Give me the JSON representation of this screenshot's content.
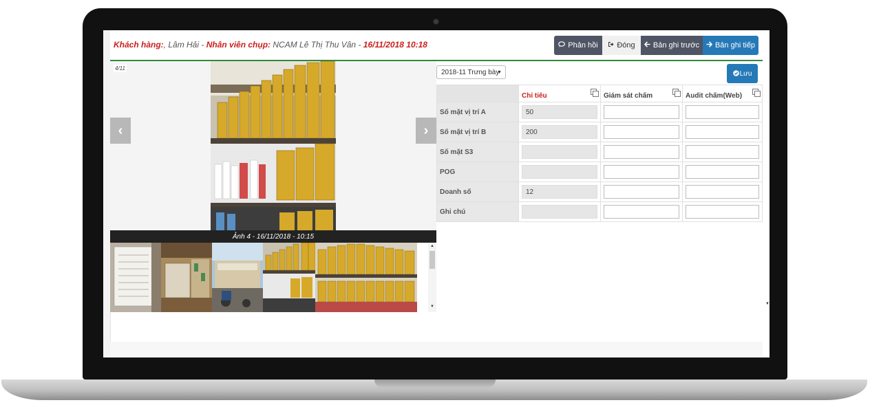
{
  "header": {
    "customer_label": "Khách hàng:",
    "customer_value": ", Lâm Hải",
    "sep1": " - ",
    "staff_label": "Nhân viên chụp:",
    "staff_value": " NCAM Lê Thị Thu Vân",
    "sep2": " - ",
    "datetime": "16/11/2018 10:18"
  },
  "toolbar": {
    "feedback_label": "Phản hồi",
    "close_label": "Đóng",
    "prev_label": "Bản ghi trước",
    "next_label": "Bản ghi tiếp"
  },
  "viewer": {
    "counter": "4/11",
    "caption": "Ảnh 4 - 16/11/2018 - 10:15"
  },
  "form": {
    "period_select": "2018-11 Trưng bày",
    "save_label": "Lưu",
    "columns": [
      "",
      "Chỉ tiêu",
      "Giám sát chấm",
      "Audit chấm(Web)"
    ],
    "rows": [
      {
        "label": "Số mặt vị trí A",
        "target": "50"
      },
      {
        "label": "Số mặt vị trí B",
        "target": "200"
      },
      {
        "label": "Số mặt S3",
        "target": ""
      },
      {
        "label": "POG",
        "target": ""
      },
      {
        "label": "Doanh số",
        "target": "12"
      },
      {
        "label": "Ghi chú",
        "target": ""
      }
    ]
  },
  "colors": {
    "accent_red": "#c9201e",
    "primary_blue": "#2679b7",
    "dark_button": "#4f5564",
    "header_rule": "#2f8a3a"
  },
  "icons": [
    "comment-icon",
    "sign-out-icon",
    "arrow-left-icon",
    "arrow-right-icon",
    "check-circle-icon",
    "copy-icon",
    "chevron-left-icon",
    "chevron-right-icon"
  ]
}
